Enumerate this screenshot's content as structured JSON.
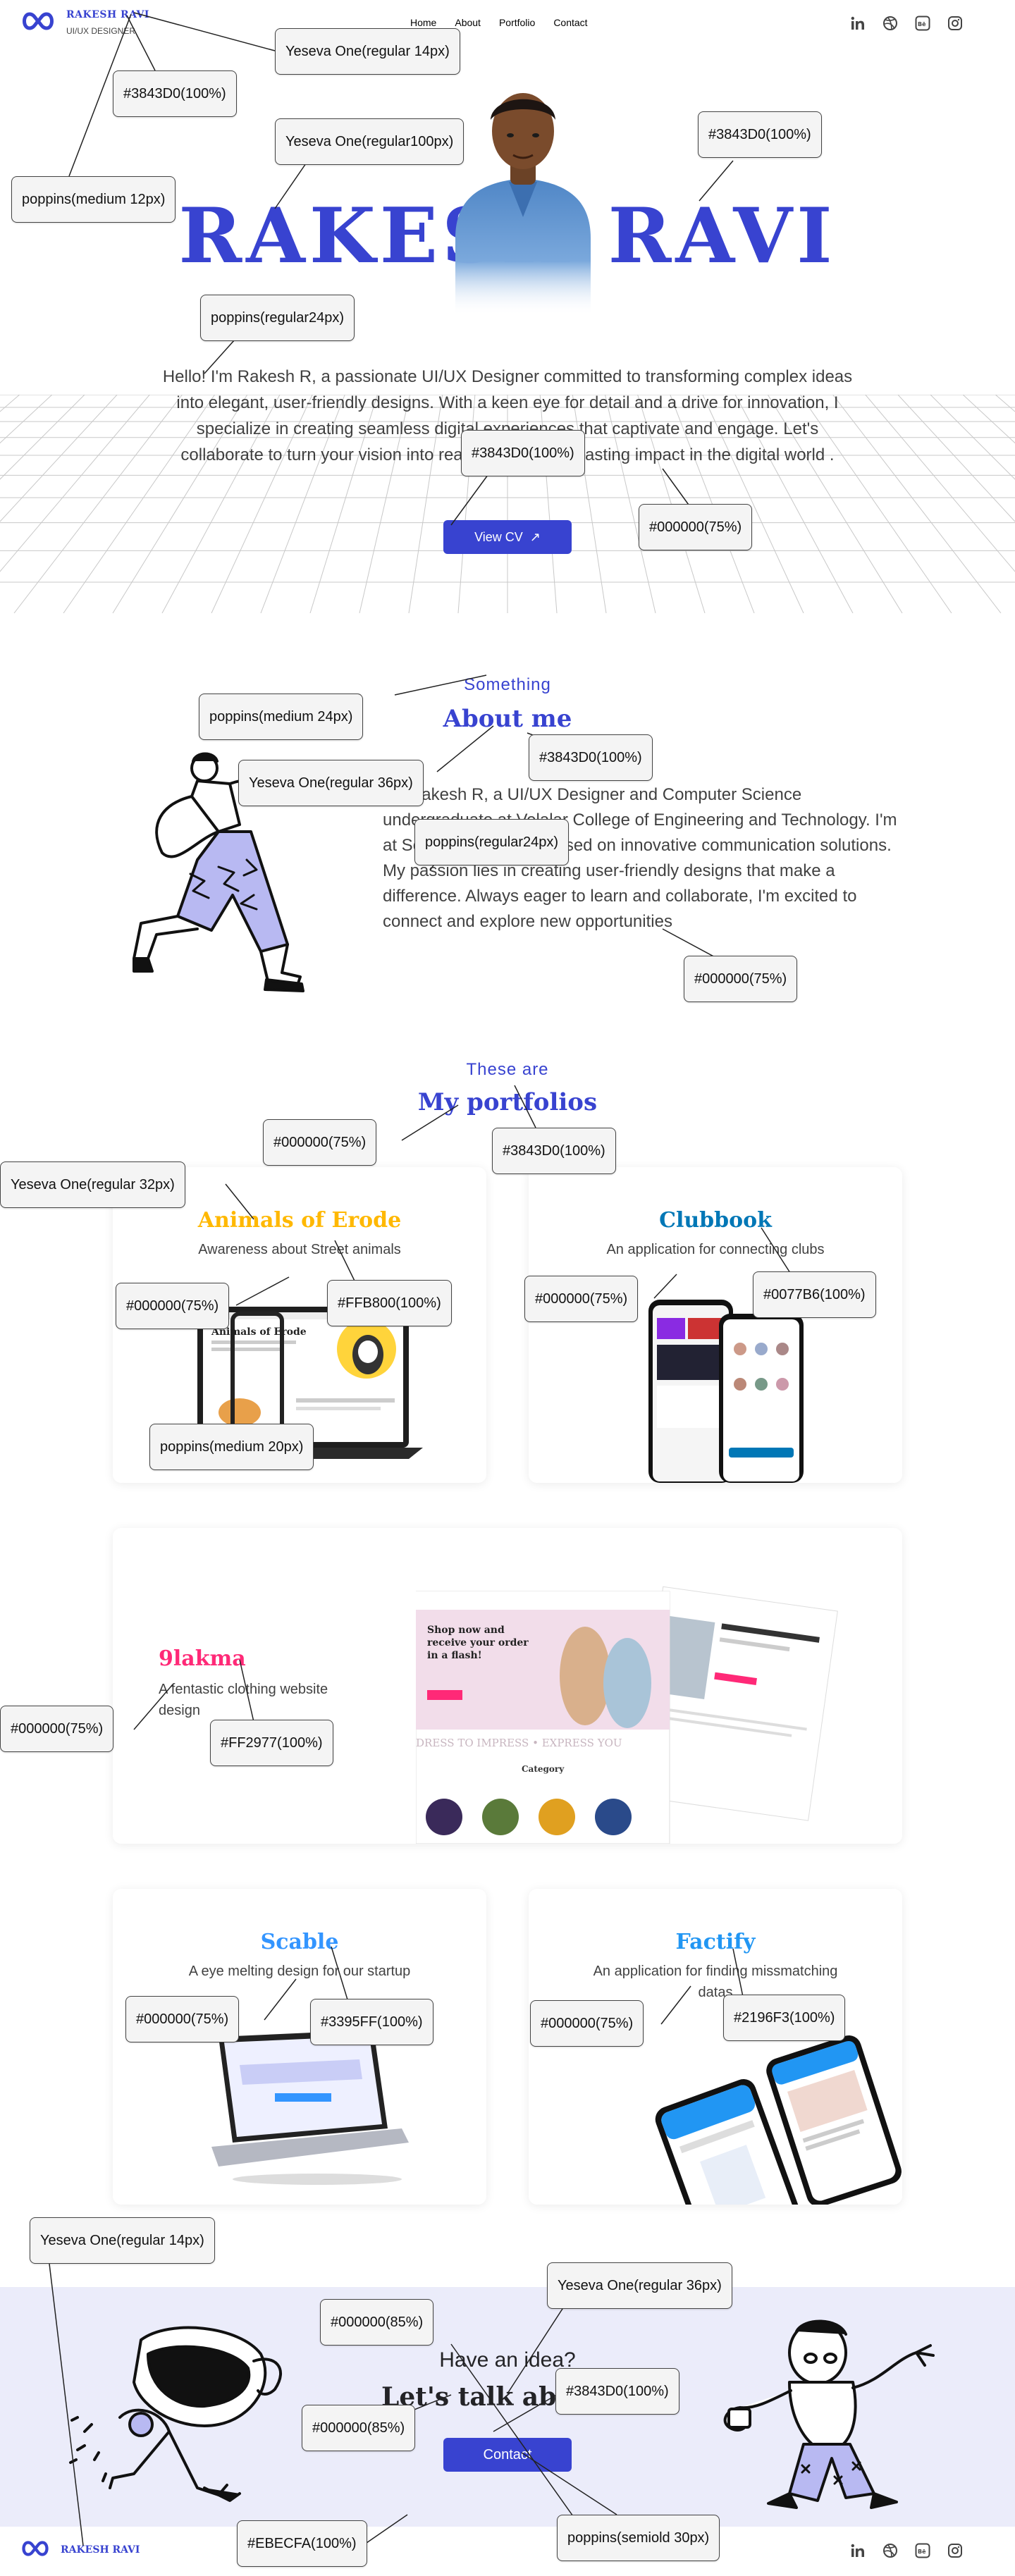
{
  "header": {
    "brand_name": "RAKESH RAVI",
    "brand_role": "UI/UX DESIGNER",
    "nav": [
      "Home",
      "About",
      "Portfolio",
      "Contact"
    ],
    "social_icons": [
      "linkedin-icon",
      "dribbble-icon",
      "behance-icon",
      "instagram-icon"
    ]
  },
  "hero": {
    "name": "RAKESH RAVI",
    "intro": "Hello! I'm Rakesh R, a passionate UI/UX Designer committed to transforming complex ideas into elegant, user-friendly designs. With a keen eye for detail and a drive for innovation, I specialize in creating seamless digital experiences that captivate and engage. Let's collaborate to turn your vision into reality and make a lasting impact in the digital world .",
    "cv_button": "View CV",
    "cv_icon": "↗"
  },
  "about": {
    "kicker": "Something",
    "title": "About me",
    "text": "I'm Rakesh R, a UI/UX Designer and Computer Science undergraduate at Velalar College of Engineering and Technology. I'm at Scable, a startup focused on innovative communication solutions. My passion lies in creating user-friendly designs that make a difference. Always eager to learn and collaborate, I'm excited to connect and explore new opportunities"
  },
  "portfolio": {
    "kicker": "These are",
    "title": "My portfolios",
    "projects": [
      {
        "title": "Animals of Erode",
        "desc": "Awareness about Street animals",
        "color": "#FFB800"
      },
      {
        "title": "Clubbook",
        "desc": "An application for connecting clubs",
        "color": "#0077B6"
      },
      {
        "title": "9lakma",
        "desc": "A fentastic clothing website design",
        "color": "#FF2977"
      },
      {
        "title": "Scable",
        "desc": "A eye melting design for our startup",
        "color": "#3395FF"
      },
      {
        "title": "Factify",
        "desc": "An application for finding missmatching datas",
        "color": "#2196F3"
      }
    ],
    "mock_texts": {
      "animals_heading": "Animals of Erode",
      "ninelakma_headline": "Shop now and receive your order in a flash!",
      "ninelakma_marquee": "DRESS TO IMPRESS • EXPRESS YOU",
      "ninelakma_category": "Category"
    }
  },
  "contact": {
    "kicker": "Have an idea?",
    "title": "Let's talk about it",
    "button": "Contact"
  },
  "footer": {
    "brand_name": "RAKESH RAVI"
  },
  "annotations": [
    "Yeseva One(regular 14px)",
    "#3843D0(100%)",
    "Yeseva One(regular100px)",
    "#3843D0(100%)",
    "poppins(medium 12px)",
    "poppins(regular24px)",
    "#3843D0(100%)",
    "#000000(75%)",
    "poppins(medium 24px)",
    "Yeseva One(regular 36px)",
    "#3843D0(100%)",
    "poppins(regular24px)",
    "#000000(75%)",
    "#000000(75%)",
    "#3843D0(100%)",
    "Yeseva One(regular 32px)",
    "#000000(75%)",
    "#FFB800(100%)",
    "poppins(medium 20px)",
    "#000000(75%)",
    "#0077B6(100%)",
    "#000000(75%)",
    "#FF2977(100%)",
    "#000000(75%)",
    "#3395FF(100%)",
    "#000000(75%)",
    "#2196F3(100%)",
    "Yeseva One(regular 14px)",
    "Yeseva One(regular 36px)",
    "#000000(85%)",
    "#3843D0(100%)",
    "#000000(85%)",
    "#EBECFA(100%)",
    "poppins(semiold 30px)"
  ]
}
